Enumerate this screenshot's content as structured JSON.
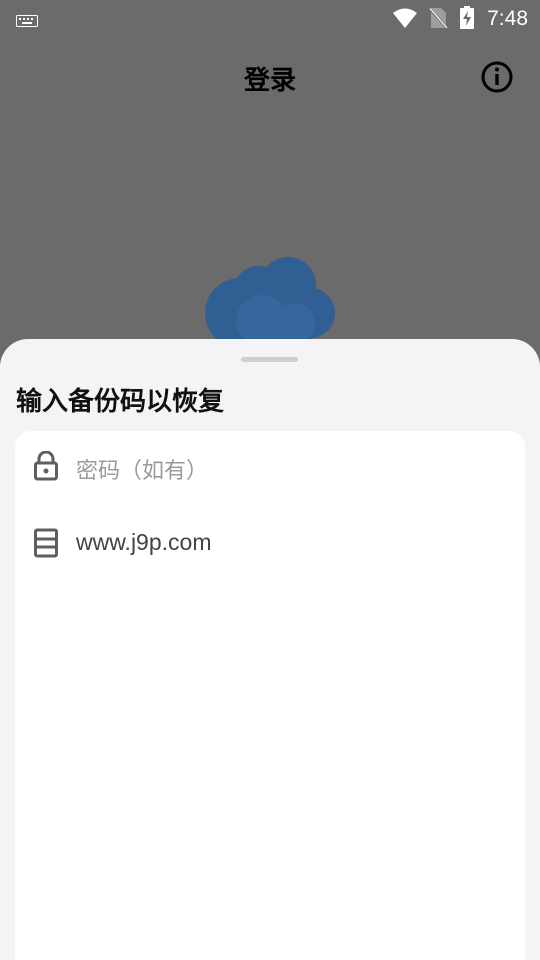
{
  "status_bar": {
    "time": "7:48",
    "icons": [
      "keyboard-icon",
      "wifi-icon",
      "no-sim-icon",
      "battery-charging-icon"
    ]
  },
  "app_bar": {
    "title": "登录",
    "info_icon": "info-icon"
  },
  "logo": {
    "icon": "cloud-icon",
    "color": "#2f5f93"
  },
  "sheet": {
    "title": "输入备份码以恢复",
    "fields": {
      "password": {
        "placeholder": "密码（如有）",
        "icon": "lock-icon"
      },
      "server": {
        "value": "www.j9p.com",
        "icon": "server-icon"
      }
    }
  },
  "colors": {
    "scrim": "#6b6b6b",
    "sheet_background": "#f4f4f4",
    "card_background": "#ffffff"
  }
}
